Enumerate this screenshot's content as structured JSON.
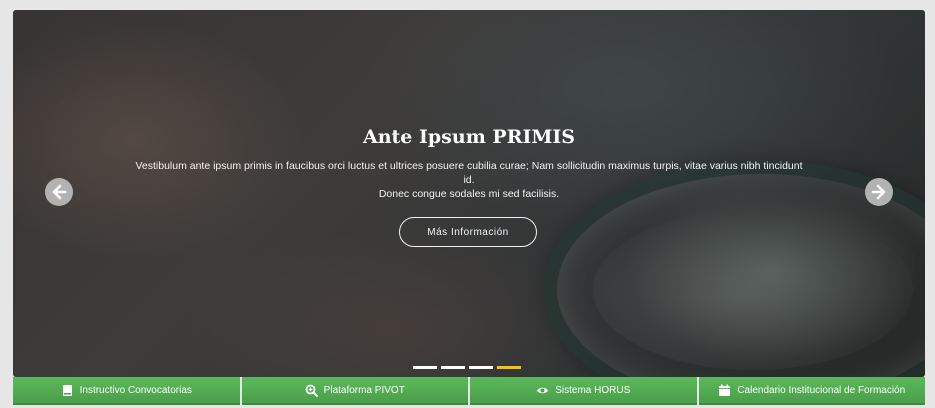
{
  "slide": {
    "title": "Ante Ipsum PRIMIS",
    "text_line1": "Vestibulum ante ipsum primis in faucibus orci luctus et ultrices posuere cubilia curae; Nam sollicitudin maximus turpis, vitae varius nibh tincidunt id.",
    "text_line2": "Donec congue sodales mi sed facilisis.",
    "button_label": "Más Información"
  },
  "carousel": {
    "slide_count": 4,
    "active_index": 3,
    "indicator_color": "#ffffff",
    "indicator_active_color": "#f1c40f"
  },
  "footer": {
    "accent_color": "#5cb85c",
    "items": [
      {
        "label": "Instructivo Convocatorias",
        "icon": "book-icon"
      },
      {
        "label": "Plataforma PIVOT",
        "icon": "search-plus-icon"
      },
      {
        "label": "Sistema HORUS",
        "icon": "eye-icon"
      },
      {
        "label": "Calendario Institucional de Formación",
        "icon": "calendar-icon"
      }
    ]
  }
}
